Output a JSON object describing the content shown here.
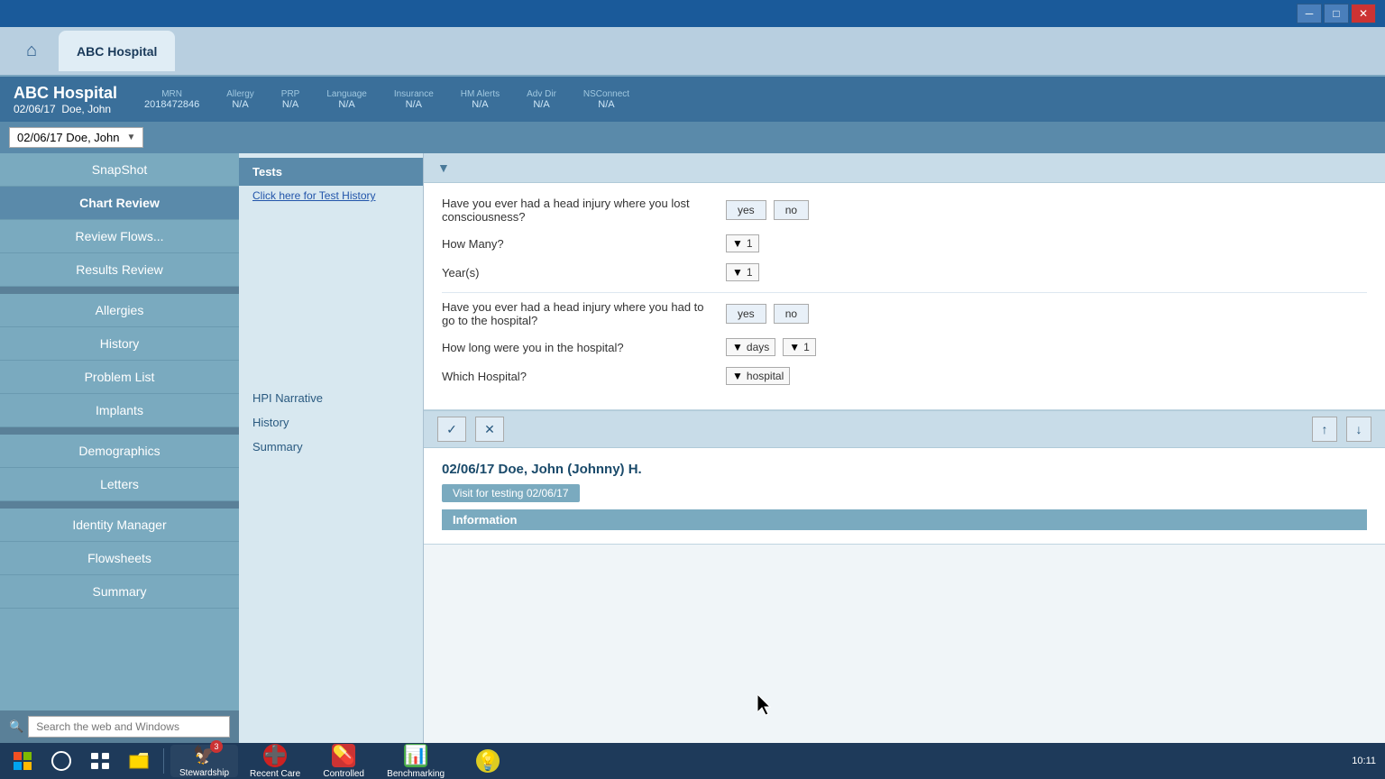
{
  "titlebar": {
    "minimize": "─",
    "maximize": "□",
    "close": "✕"
  },
  "header": {
    "home_icon": "⌂",
    "hospital_tab": "ABC Hospital"
  },
  "patient": {
    "name": "ABC Hospital",
    "date": "02/06/17",
    "display_name": "Doe, John",
    "mrn_label": "MRN",
    "mrn_value": "2018472846",
    "allergy_label": "Allergy",
    "allergy_value": "N/A",
    "prp_label": "PRP",
    "prp_value": "N/A",
    "language_label": "Language",
    "language_value": "N/A",
    "insurance_label": "Insurance",
    "insurance_value": "N/A",
    "hm_alerts_label": "HM Alerts",
    "hm_alerts_value": "N/A",
    "adv_dir_label": "Adv Dir",
    "adv_dir_value": "N/A",
    "nsconnect_label": "NSConnect",
    "nsconnect_value": "N/A"
  },
  "visit_bar": {
    "visit_label": "02/06/17  Doe, John"
  },
  "sidebar": {
    "items": [
      {
        "id": "snapshot",
        "label": "SnapShot"
      },
      {
        "id": "chart-review",
        "label": "Chart Review"
      },
      {
        "id": "review-flows",
        "label": "Review Flows..."
      },
      {
        "id": "results-review",
        "label": "Results Review"
      },
      {
        "id": "allergies",
        "label": "Allergies"
      },
      {
        "id": "history",
        "label": "History"
      },
      {
        "id": "problem-list",
        "label": "Problem List"
      },
      {
        "id": "implants",
        "label": "Implants"
      },
      {
        "id": "demographics",
        "label": "Demographics"
      },
      {
        "id": "letters",
        "label": "Letters"
      },
      {
        "id": "identity-manager",
        "label": "Identity Manager"
      },
      {
        "id": "flowsheets",
        "label": "Flowsheets"
      },
      {
        "id": "summary",
        "label": "Summary"
      }
    ],
    "search_placeholder": "Search the web and Windows"
  },
  "middle_panel": {
    "active_item": "Tests",
    "items": [
      {
        "id": "tests",
        "label": "Tests"
      }
    ],
    "link": "Click here for Test History",
    "sub_items": [
      {
        "id": "hpi-narrative",
        "label": "HPI Narrative"
      },
      {
        "id": "history",
        "label": "History"
      },
      {
        "id": "summary",
        "label": "Summary"
      }
    ]
  },
  "form": {
    "question1": {
      "text": "Have you ever had a head injury where you lost consciousness?",
      "yes": "yes",
      "no": "no"
    },
    "how_many_label": "How Many?",
    "how_many_value": "1",
    "years_label": "Year(s)",
    "years_value": "1",
    "question2": {
      "text": "Have you ever had a head injury where you had to go to the hospital?",
      "yes": "yes",
      "no": "no"
    },
    "how_long_label": "How long were you in the hospital?",
    "days_value": "days",
    "days_number": "1",
    "which_hospital_label": "Which Hospital?",
    "hospital_value": "hospital"
  },
  "visit_entry": {
    "title": "02/06/17  Doe, John (Johnny) H.",
    "tag": "Visit for testing 02/06/17",
    "info_bar": "Information"
  },
  "taskbar": {
    "apps": [
      {
        "id": "stewardship",
        "icon": "🦅",
        "label": "Stewardship",
        "badge": "3"
      },
      {
        "id": "recent-care",
        "icon": "➕",
        "label": "Recent Care",
        "badge": null
      },
      {
        "id": "controlled",
        "icon": "💊",
        "label": "Controlled",
        "badge": null
      },
      {
        "id": "benchmarking",
        "icon": "📊",
        "label": "Benchmarking",
        "badge": null
      },
      {
        "id": "light",
        "icon": "💡",
        "label": "",
        "badge": null
      }
    ],
    "time": "10:11"
  }
}
